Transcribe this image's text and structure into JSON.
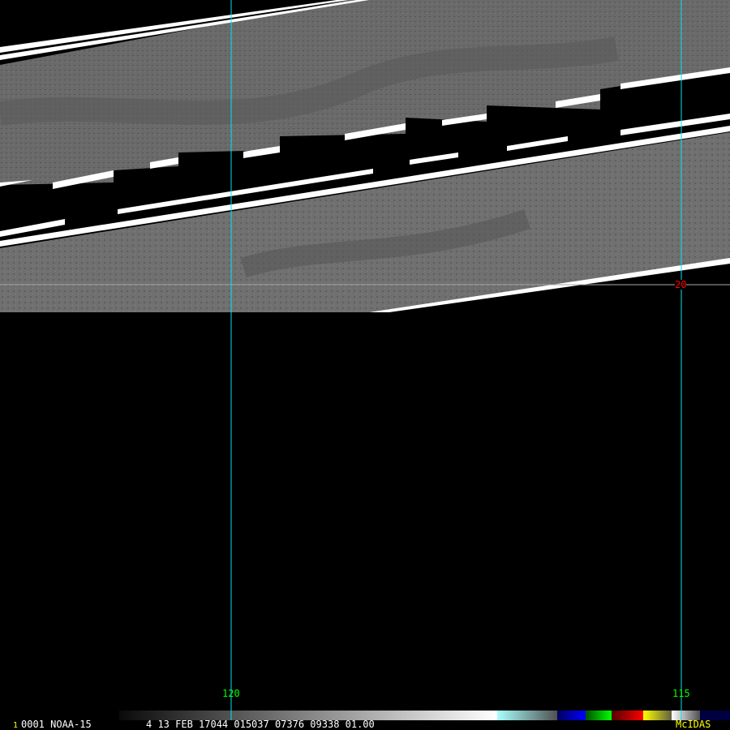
{
  "image": {
    "frame_number": "1",
    "info_line": "0001 NOAA-15",
    "header_line": "4 13 FEB 17044 015037 07376 09338 01.00",
    "logo": "McIDAS"
  },
  "grid": {
    "longitude_labels": [
      "120",
      "115"
    ],
    "latitude_labels": [
      "20"
    ],
    "colors": {
      "longitude_line": "#00e5ee",
      "latitude_line": "#aaaaaa",
      "longitude_label": "#00ff00",
      "latitude_label": "#ff0000"
    }
  },
  "colorbar": {
    "segments": [
      {
        "name": "grayscale",
        "from": "#0a0a0a",
        "to": "#ffffff"
      },
      {
        "name": "cyan",
        "from": "#a8ffff",
        "to": "#505050"
      },
      {
        "name": "blue",
        "from": "#000060",
        "to": "#0000ff"
      },
      {
        "name": "green",
        "from": "#005000",
        "to": "#00ff00"
      },
      {
        "name": "red",
        "from": "#500000",
        "to": "#ff0000"
      },
      {
        "name": "yellow",
        "from": "#ffff00",
        "to": "#606040"
      },
      {
        "name": "white-gray",
        "from": "#ffffff",
        "to": "#505050"
      },
      {
        "name": "navy",
        "from": "#000040",
        "to": "#000040"
      }
    ]
  }
}
